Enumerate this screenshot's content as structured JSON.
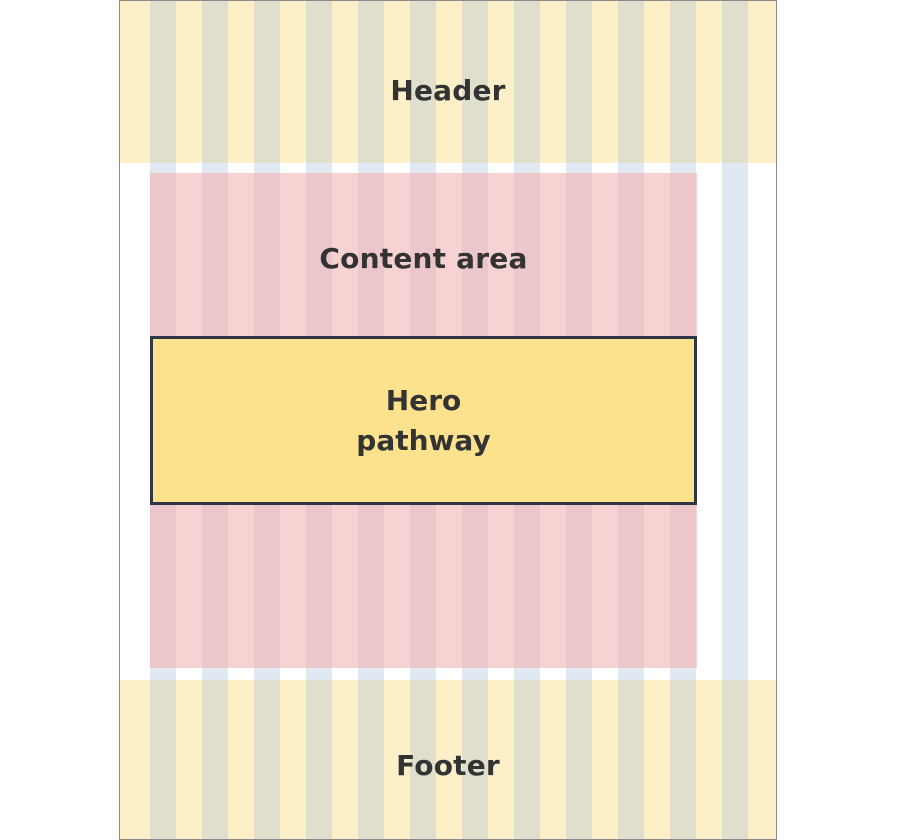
{
  "diagram": {
    "header": {
      "label": "Header"
    },
    "content_area": {
      "label": "Content area"
    },
    "hero": {
      "line1": "Hero",
      "line2": "pathway"
    },
    "footer": {
      "label": "Footer"
    },
    "column_count": 12
  },
  "colors": {
    "frame_border": "#8a8a8a",
    "band_fill": "#fdf0c8",
    "band_column": "#e0dfcd",
    "content_fill": "#f7d2d3",
    "content_column": "#ebc6ca",
    "gutter_column": "#e0e8f2",
    "hero_fill": "#fde28e",
    "hero_border": "#2e3648",
    "text": "#333333"
  }
}
